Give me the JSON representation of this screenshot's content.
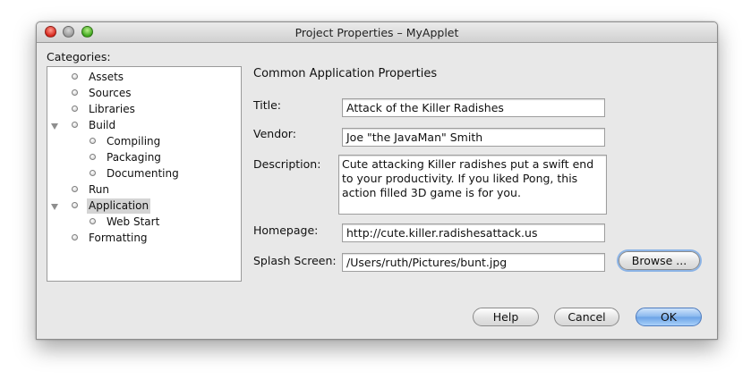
{
  "window": {
    "title": "Project Properties – MyApplet"
  },
  "sidebar": {
    "label": "Categories:",
    "items": [
      {
        "label": "Assets"
      },
      {
        "label": "Sources"
      },
      {
        "label": "Libraries"
      },
      {
        "label": "Build",
        "expanded": true
      },
      {
        "label": "Compiling"
      },
      {
        "label": "Packaging"
      },
      {
        "label": "Documenting"
      },
      {
        "label": "Run"
      },
      {
        "label": "Application",
        "expanded": true,
        "selected": true
      },
      {
        "label": "Web Start"
      },
      {
        "label": "Formatting"
      }
    ]
  },
  "main": {
    "section_title": "Common Application Properties",
    "title_label": "Title:",
    "title_value": "Attack of the Killer Radishes",
    "vendor_label": "Vendor:",
    "vendor_value": "Joe \"the JavaMan\" Smith",
    "description_label": "Description:",
    "description_value": "Cute attacking Killer radishes put a swift end to your productivity. If you liked Pong, this action filled 3D game is for you.",
    "homepage_label": "Homepage:",
    "homepage_value": "http://cute.killer.radishesattack.us",
    "splash_label": "Splash Screen:",
    "splash_value": "/Users/ruth/Pictures/bunt.jpg",
    "browse_label": "Browse ..."
  },
  "buttons": {
    "help": "Help",
    "cancel": "Cancel",
    "ok": "OK"
  },
  "colors": {
    "ok_button": "#6aa2e6",
    "selection": "#d4d4d4",
    "close_light": "#d6261c",
    "zoom_light": "#3fa71d"
  }
}
